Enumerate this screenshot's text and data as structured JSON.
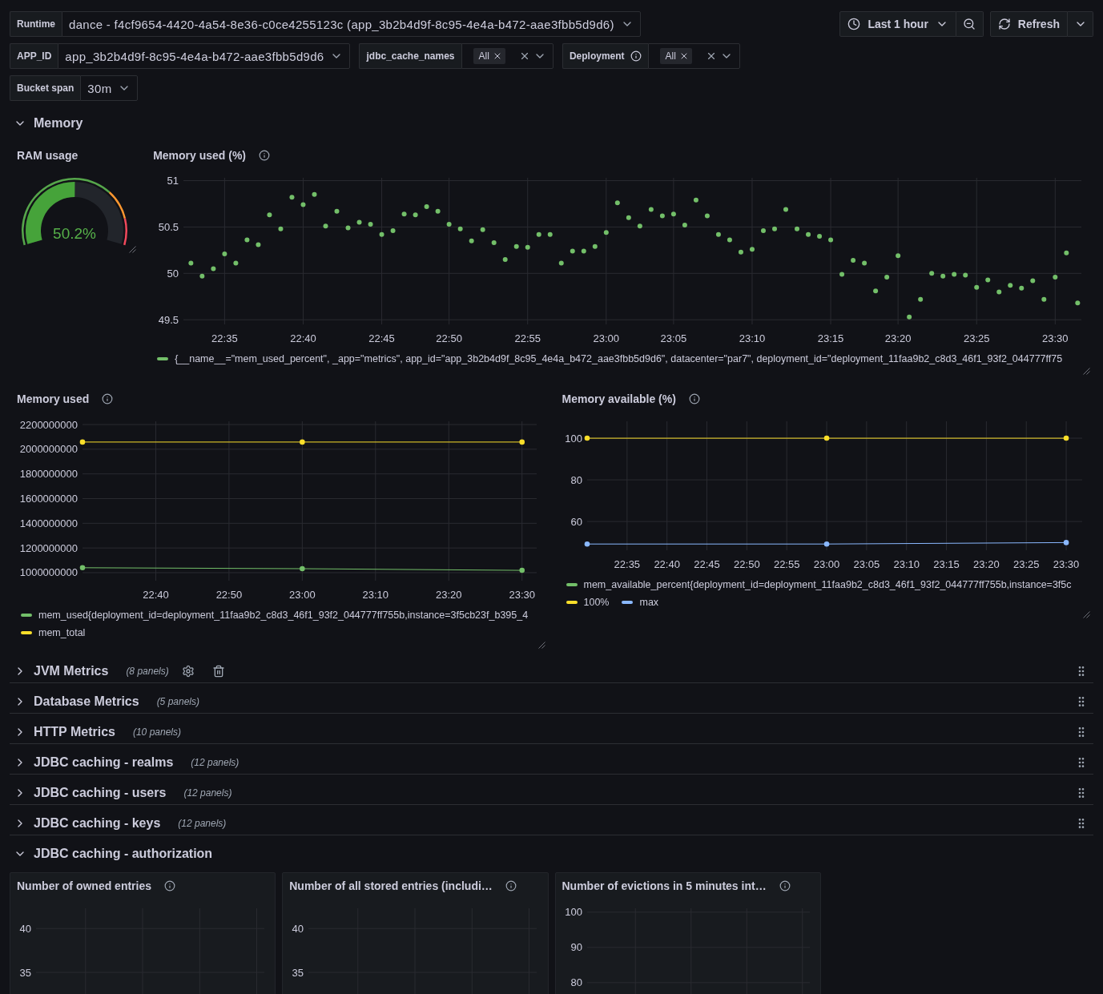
{
  "variable_rows": [
    [
      {
        "kind": "select",
        "label": "Runtime",
        "has_info": false,
        "value": "dance - f4cf9654-4420-4a54-8e36-c0ce4255123c (app_3b2b4d9f-8c95-4e4a-b472-aae3fbb5d9d6)"
      }
    ],
    [
      {
        "kind": "select",
        "label": "APP_ID",
        "has_info": false,
        "value": "app_3b2b4d9f-8c95-4e4a-b472-aae3fbb5d9d6"
      },
      {
        "kind": "multi",
        "label": "jdbc_cache_names",
        "has_info": false,
        "chips": [
          "All"
        ]
      },
      {
        "kind": "multi",
        "label": "Deployment",
        "has_info": true,
        "chips": [
          "All"
        ]
      }
    ],
    [
      {
        "kind": "select",
        "label": "Bucket span",
        "has_info": false,
        "value": "30m"
      }
    ]
  ],
  "time_picker": {
    "label": "Last 1 hour"
  },
  "refresh": {
    "label": "Refresh"
  },
  "sections": [
    {
      "title": "Memory",
      "expanded": true,
      "actions_visible": false,
      "panels": [
        {
          "kind": "gauge",
          "title": "RAM usage",
          "has_info": false,
          "transparent": true,
          "value": "50.2%",
          "level": 0.502
        },
        {
          "kind": "chart",
          "title": "Memory used (%)",
          "has_info": true,
          "transparent": true,
          "chart_data": {
            "type": "scatter",
            "grid": true,
            "categories": [
              null,
              null,
              null,
              "22:35",
              null,
              null,
              null,
              null,
              null,
              null,
              "22:40",
              null,
              null,
              null,
              null,
              null,
              null,
              "22:45",
              null,
              null,
              null,
              null,
              null,
              "22:50",
              null,
              null,
              null,
              null,
              null,
              null,
              "22:55",
              null,
              null,
              null,
              null,
              null,
              null,
              "23:00",
              null,
              null,
              null,
              null,
              null,
              "23:05",
              null,
              null,
              null,
              null,
              null,
              null,
              "23:10",
              null,
              null,
              null,
              null,
              null,
              null,
              "23:15",
              null,
              null,
              null,
              null,
              null,
              "23:20",
              null,
              null,
              null,
              null,
              null,
              null,
              "23:25",
              null,
              null,
              null,
              null,
              null,
              null,
              "23:30",
              null,
              null
            ],
            "series": [
              {
                "name": "{__name__=\"mem_used_percent\", _app=\"metrics\", app_id=\"app_3b2b4d9f_8c95_4e4a_b472_aae3fbb5d9d6\", datacenter=\"par7\", deployment_id=\"deployment_11faa9b2_c8d3_46f1_93f2_044777ff75",
                "color": "#73bf69",
                "values": [
                  50.11,
                  49.97,
                  50.05,
                  50.21,
                  50.11,
                  50.36,
                  50.31,
                  50.63,
                  50.48,
                  50.82,
                  50.74,
                  50.85,
                  50.51,
                  50.67,
                  50.49,
                  50.55,
                  50.53,
                  50.42,
                  50.46,
                  50.64,
                  50.63,
                  50.72,
                  50.67,
                  50.53,
                  50.48,
                  50.35,
                  50.47,
                  50.33,
                  50.15,
                  50.29,
                  50.28,
                  50.42,
                  50.42,
                  50.11,
                  50.24,
                  50.24,
                  50.29,
                  50.44,
                  50.76,
                  50.6,
                  50.51,
                  50.69,
                  50.62,
                  50.64,
                  50.52,
                  50.79,
                  50.62,
                  50.42,
                  50.36,
                  50.23,
                  50.26,
                  50.46,
                  50.48,
                  50.69,
                  50.48,
                  50.42,
                  50.4,
                  50.36,
                  49.99,
                  50.14,
                  50.11,
                  49.81,
                  49.96,
                  50.19,
                  49.53,
                  49.72,
                  50,
                  49.97,
                  49.99,
                  49.98,
                  49.85,
                  49.93,
                  49.8,
                  49.87,
                  49.84,
                  49.92,
                  49.72,
                  49.96,
                  50.22,
                  49.68
                ]
              }
            ],
            "ylim": [
              49.45,
              51.03
            ],
            "yticks": [
              51,
              50.5,
              50,
              49.5
            ]
          }
        },
        {
          "kind": "chart",
          "title": "Memory used",
          "has_info": true,
          "transparent": true,
          "chart_data": {
            "type": "line",
            "grid": true,
            "categories": [
              null,
              null,
              "22:40",
              null,
              "22:50",
              null,
              "23:00",
              null,
              "23:10",
              null,
              "23:20",
              null,
              "23:30"
            ],
            "series": [
              {
                "name": "mem_used{deployment_id=deployment_11faa9b2_c8d3_46f1_93f2_044777ff755b,instance=3f5cb23f_b395_4",
                "color": "#73bf69",
                "marker": "circle",
                "values": [
                  1040000000,
                  null,
                  null,
                  null,
                  null,
                  null,
                  1032000000,
                  null,
                  null,
                  null,
                  null,
                  null,
                  1019000000
                ]
              },
              {
                "name": "mem_total",
                "color": "#fade2a",
                "marker": "circle",
                "values": [
                  2058000000,
                  null,
                  null,
                  null,
                  null,
                  null,
                  2058000000,
                  null,
                  null,
                  null,
                  null,
                  null,
                  2058000000
                ]
              }
            ],
            "ylim": [
              935000000,
              2226000000
            ],
            "yticks": [
              2200000000,
              2000000000,
              1800000000,
              1600000000,
              1400000000,
              1200000000,
              1000000000
            ]
          }
        },
        {
          "kind": "chart",
          "title": "Memory available (%)",
          "has_info": true,
          "transparent": true,
          "chart_data": {
            "type": "line",
            "grid": true,
            "categories": [
              null,
              "22:35",
              "22:40",
              "22:45",
              "22:50",
              "22:55",
              "23:00",
              "23:05",
              "23:10",
              "23:15",
              "23:20",
              "23:25",
              "23:30"
            ],
            "series": [
              {
                "name": "mem_available_percent{deployment_id=deployment_11faa9b2_c8d3_46f1_93f2_044777ff755b,instance=3f5c",
                "color": "#73bf69",
                "values": [
                  null,
                  null,
                  null,
                  null,
                  null,
                  null,
                  null,
                  null,
                  null,
                  null,
                  null,
                  null,
                  null
                ]
              },
              {
                "name": "100%",
                "color": "#fade2a",
                "marker": "circle",
                "values": [
                  100,
                  null,
                  null,
                  null,
                  null,
                  null,
                  100,
                  null,
                  null,
                  null,
                  null,
                  null,
                  100
                ]
              },
              {
                "name": "max",
                "color": "#8ab8ff",
                "marker": "circle",
                "values": [
                  49.2,
                  null,
                  null,
                  null,
                  null,
                  null,
                  49.2,
                  null,
                  null,
                  null,
                  null,
                  null,
                  49.9
                ]
              }
            ],
            "ylim": [
              46.2,
              108.1
            ],
            "yticks": [
              100,
              80,
              60
            ]
          }
        }
      ]
    },
    {
      "title": "JVM Metrics",
      "expanded": false,
      "panel_count": "(8 panels)",
      "actions_visible": true
    },
    {
      "title": "Database Metrics",
      "expanded": false,
      "panel_count": "(5 panels)",
      "actions_visible": false
    },
    {
      "title": "HTTP Metrics",
      "expanded": false,
      "panel_count": "(10 panels)",
      "actions_visible": false
    },
    {
      "title": "JDBC caching - realms",
      "expanded": false,
      "panel_count": "(12 panels)",
      "actions_visible": false
    },
    {
      "title": "JDBC caching - users",
      "expanded": false,
      "panel_count": "(12 panels)",
      "actions_visible": false
    },
    {
      "title": "JDBC caching - keys",
      "expanded": false,
      "panel_count": "(12 panels)",
      "actions_visible": false
    },
    {
      "title": "JDBC caching - authorization",
      "expanded": true,
      "actions_visible": false,
      "panels": [
        {
          "kind": "chart",
          "title": "Number of owned entries",
          "has_info": true,
          "transparent": false,
          "chart_data": {
            "type": "line",
            "grid": true,
            "categories": [
              null,
              null,
              null,
              null
            ],
            "ylim": [
              23.6,
              42.3
            ],
            "yticks": [
              40,
              35
            ]
          }
        },
        {
          "kind": "chart",
          "title": "Number of all stored entries (includi…",
          "has_info": true,
          "transparent": false,
          "chart_data": {
            "type": "line",
            "grid": true,
            "categories": [
              null,
              null,
              null,
              null
            ],
            "ylim": [
              23.6,
              42.3
            ],
            "yticks": [
              40,
              35
            ]
          }
        },
        {
          "kind": "chart",
          "title": "Number of evictions in 5 minutes int…",
          "has_info": true,
          "transparent": false,
          "chart_data": {
            "type": "line",
            "grid": true,
            "categories": [
              null,
              null,
              null,
              null
            ],
            "ylim": [
              54.5,
              101.1
            ],
            "yticks": [
              100,
              90,
              80
            ]
          }
        }
      ]
    }
  ]
}
